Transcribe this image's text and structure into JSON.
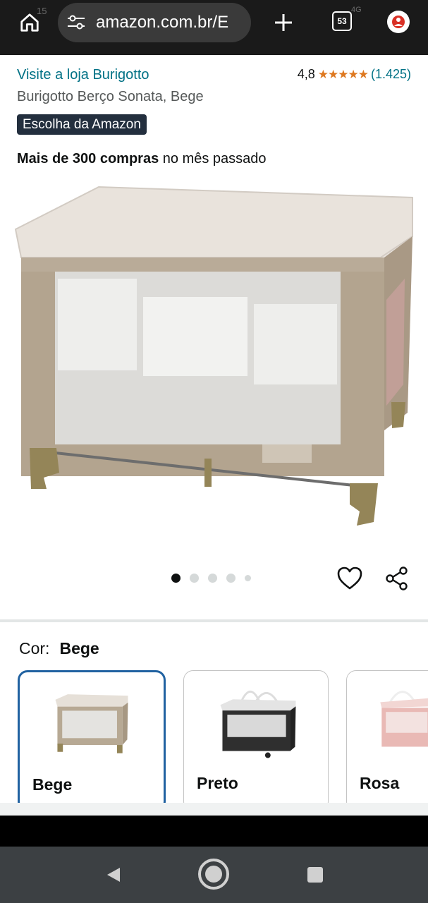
{
  "browser": {
    "status_time": "15",
    "signal": "4G",
    "url": "amazon.com.br/E",
    "tabs_count": "53"
  },
  "product": {
    "store_link": "Visite a loja Burigotto",
    "rating": "4,8",
    "stars": "★★★★★",
    "rating_count": "(1.425)",
    "title": "Burigotto Berço Sonata, Bege",
    "badge": "Escolha da Amazon",
    "bought_bold": "Mais de 300 compras",
    "bought_rest": " no mês passado",
    "image_index": 1,
    "image_total": 5
  },
  "colors": {
    "label": "Cor:",
    "selected": "Bege",
    "options": [
      {
        "name": "Bege",
        "frame_color": "#b7a994",
        "selected": true
      },
      {
        "name": "Preto",
        "frame_color": "#2f2f2f",
        "selected": false
      },
      {
        "name": "Rosa",
        "frame_color": "#e9b9b5",
        "selected": false
      }
    ]
  },
  "icons": {
    "home": "home-icon",
    "tune": "tune-icon",
    "plus": "plus-icon",
    "tabs": "tabs-icon",
    "avatar": "avatar-icon",
    "heart": "heart-icon",
    "share": "share-icon",
    "nav_back": "back-triangle-icon",
    "nav_home": "home-circle-icon",
    "nav_recent": "recent-square-icon"
  },
  "theme": {
    "link": "#007185",
    "star": "#de7921",
    "badge_bg": "#232f3e",
    "selected_border": "#2162a1"
  }
}
